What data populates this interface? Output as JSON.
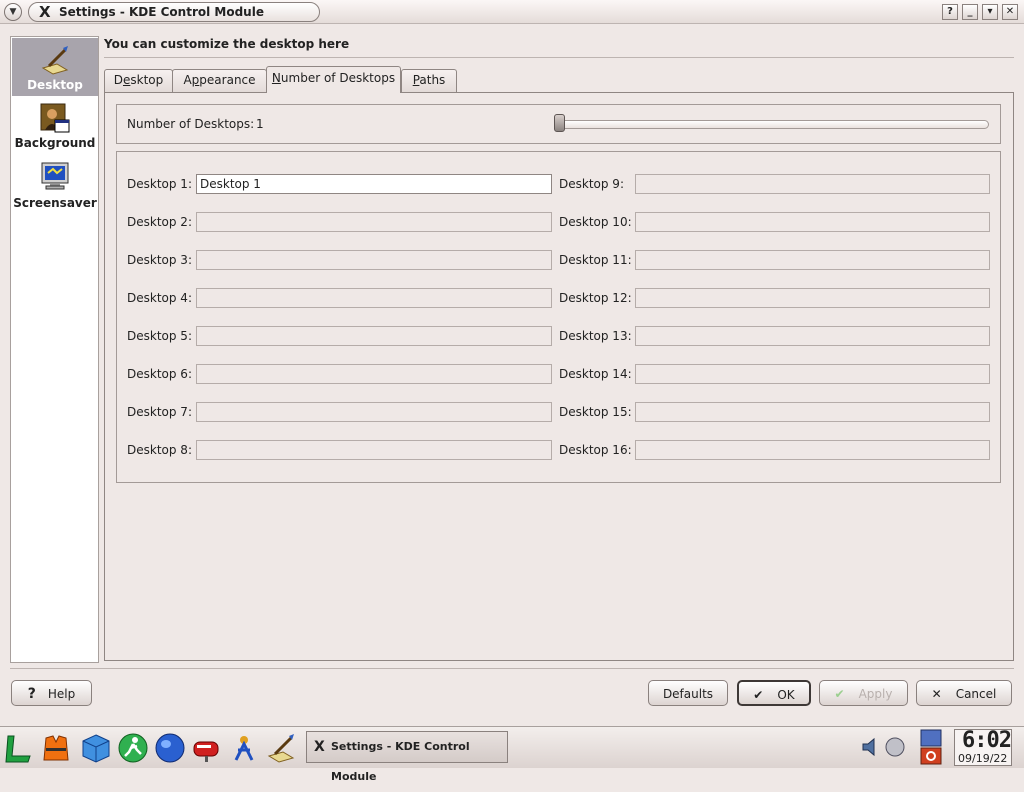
{
  "window": {
    "title": "Settings - KDE Control Module"
  },
  "sidebar": {
    "items": [
      {
        "label": "Desktop",
        "icon": "desktop-wand-icon"
      },
      {
        "label": "Background",
        "icon": "mona-lisa-icon"
      },
      {
        "label": "Screensaver",
        "icon": "monitor-icon"
      }
    ]
  },
  "header": {
    "text": "You can customize the desktop here"
  },
  "tabs": [
    {
      "label": "Desktop",
      "underline": "e",
      "pre": "D",
      "post": "sktop"
    },
    {
      "label": "Appearance",
      "pre": "A",
      "u": "p",
      "post": "pearance"
    },
    {
      "label": "Number of Desktops",
      "pre": "",
      "u": "N",
      "post": "umber of Desktops"
    },
    {
      "label": "Paths",
      "pre": "",
      "u": "P",
      "post": "aths"
    }
  ],
  "desktops": {
    "count_label": "Number of Desktops:",
    "count_value": "1",
    "slider_min": 1,
    "slider_max": 16,
    "slider_value": 1,
    "labels": [
      "Desktop 1:",
      "Desktop 2:",
      "Desktop 3:",
      "Desktop 4:",
      "Desktop 5:",
      "Desktop 6:",
      "Desktop 7:",
      "Desktop 8:",
      "Desktop 9:",
      "Desktop 10:",
      "Desktop 11:",
      "Desktop 12:",
      "Desktop 13:",
      "Desktop 14:",
      "Desktop 15:",
      "Desktop 16:"
    ],
    "names": [
      "Desktop 1",
      "",
      "",
      "",
      "",
      "",
      "",
      "",
      "",
      "",
      "",
      "",
      "",
      "",
      "",
      ""
    ]
  },
  "buttons": {
    "help": "Help",
    "defaults": "Defaults",
    "ok": "OK",
    "apply": "Apply",
    "cancel": "Cancel"
  },
  "taskbar": {
    "task_label": "Settings - KDE Control Module",
    "clock_time": "6:02",
    "clock_date": "09/19/22"
  },
  "colors": {
    "background": "#efe8e6",
    "sidebar_selected": "#a8a4ac"
  }
}
